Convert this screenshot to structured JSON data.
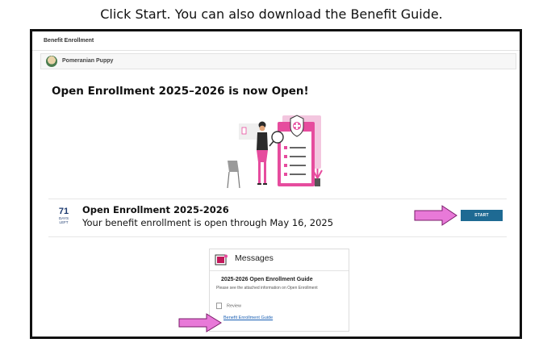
{
  "caption": "Click Start. You can also download the Benefit Guide.",
  "app": {
    "title": "Benefit Enrollment"
  },
  "user": {
    "name": "Pomeranian Puppy"
  },
  "headline": "Open Enrollment 2025–2026 is now Open!",
  "enrollment": {
    "days_left": "71",
    "days_left_label_1": "DAYS",
    "days_left_label_2": "LEFT",
    "title": "Open Enrollment 2025-2026",
    "subtitle": "Your benefit enrollment is open through May 16, 2025",
    "start_label": "START"
  },
  "messages": {
    "title": "Messages",
    "guide_title": "2025-2026 Open Enrollment Guide",
    "guide_text": "Please see the attached information on Open Enrollment",
    "review_label": "Review",
    "link_label": "Benefit Enrollment Guide"
  },
  "colors": {
    "accent": "#1e6a93",
    "highlight_arrow": "#e879d8",
    "illustration_pink": "#e64c9e"
  },
  "icons": [
    "avatar",
    "hero-illustration",
    "arrow-right-icon",
    "messages-icon",
    "document-icon"
  ]
}
